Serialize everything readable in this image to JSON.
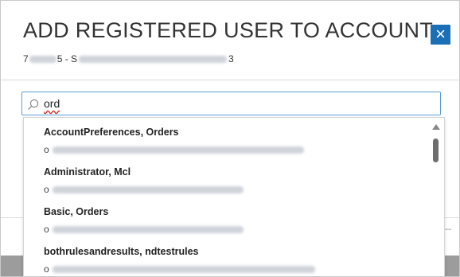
{
  "dialog": {
    "title": "ADD REGISTERED USER TO ACCOUNT",
    "subtitle_prefix": "7",
    "subtitle_mid": "5 - S",
    "subtitle_suffix": "3",
    "close_label": "×"
  },
  "search": {
    "value": "ord"
  },
  "dropdown": {
    "items": [
      {
        "name": "AccountPreferences, Orders",
        "email_prefix": "o"
      },
      {
        "name": "Administrator, Mcl",
        "email_prefix": "o"
      },
      {
        "name": "Basic, Orders",
        "email_prefix": "o"
      },
      {
        "name": "bothrulesandresults, ndtestrules",
        "email_prefix": "o"
      }
    ]
  },
  "colors": {
    "accent": "#1a6fb5",
    "search_border": "#5a9fd6",
    "overlay_band": "#9c9c9c"
  },
  "icons": [
    "close-icon",
    "search-icon",
    "scroll-up-arrow-icon"
  ]
}
